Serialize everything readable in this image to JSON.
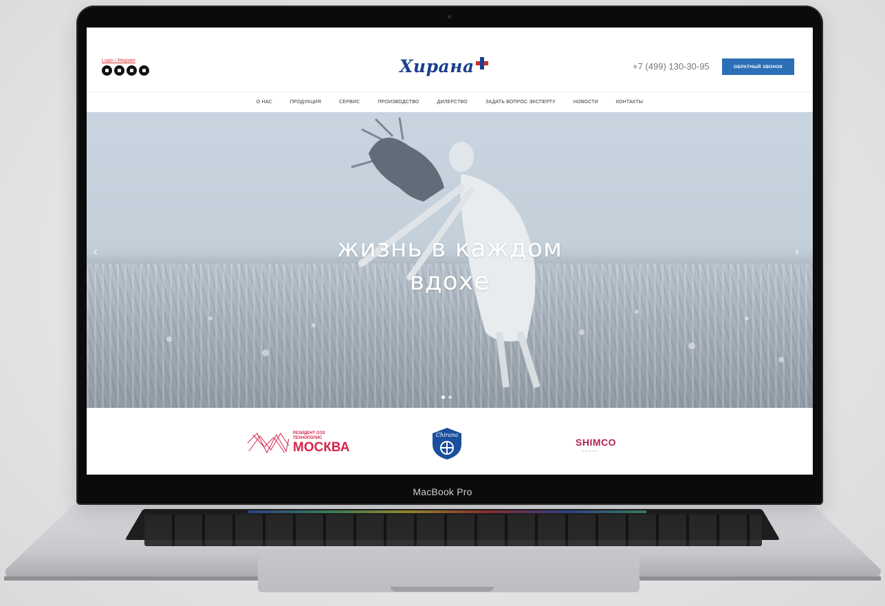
{
  "device": {
    "label": "MacBook Pro"
  },
  "site": {
    "login_link": "Login / Register",
    "social_icons": [
      "vk-icon",
      "ok-icon",
      "youtube-icon",
      "instagram-icon"
    ],
    "logo_text": "Хирана",
    "phone": "+7 (499) 130-30-95",
    "callback_button": "ОБРАТНЫЙ ЗВОНОК",
    "nav": [
      "О НАС",
      "ПРОДУКЦИЯ",
      "СЕРВИС",
      "ПРОИЗВОДСТВО",
      "ДИЛЕРСТВО",
      "ЗАДАТЬ ВОПРОС ЭКСПЕРТУ",
      "НОВОСТИ",
      "КОНТАКТЫ"
    ],
    "hero": {
      "title_line1": "жизнь в каждом",
      "title_line2": "вдохе",
      "slides": 2,
      "active_slide": 1
    },
    "partners": {
      "moscow_small_1": "РЕЗИДЕНТ ОЭЗ",
      "moscow_small_2": "ТЕХНОПОЛИС",
      "moscow_big": "МОСКВА",
      "chirana_text": "Chirana",
      "shimco": "SHIMCO",
      "shimco_sub": "GROUP"
    },
    "colors": {
      "accent": "#2c6fb7",
      "brand_blue": "#1b3f8f",
      "brand_red": "#d32a2a",
      "partner_red": "#d6234b"
    }
  }
}
